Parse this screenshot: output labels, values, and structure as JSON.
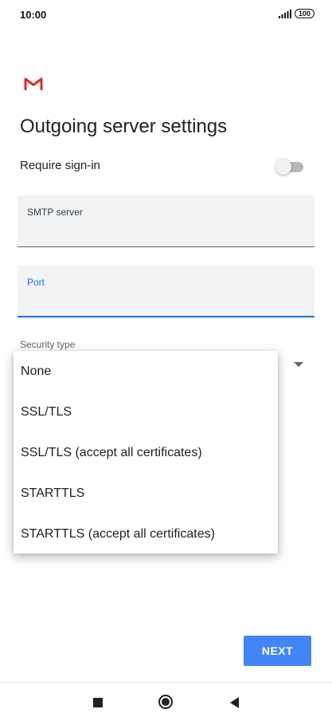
{
  "status_bar": {
    "time": "10:00",
    "battery": "100",
    "icons": [
      "signal-icon",
      "battery-icon"
    ]
  },
  "app": {
    "logo": "gmail-logo",
    "accent_color": "#4285f4",
    "logo_color": "#d93025"
  },
  "page": {
    "title": "Outgoing server settings"
  },
  "require_signin": {
    "label": "Require sign-in",
    "enabled": false
  },
  "fields": {
    "smtp_label": "SMTP server",
    "smtp_value": "",
    "port_label": "Port",
    "port_value": ""
  },
  "security": {
    "label": "Security type",
    "options": [
      "None",
      "SSL/TLS",
      "SSL/TLS (accept all certificates)",
      "STARTTLS",
      "STARTTLS (accept all certificates)"
    ]
  },
  "buttons": {
    "next": "NEXT"
  },
  "nav_bar": {
    "icons": [
      "recents-icon",
      "home-icon",
      "back-icon"
    ]
  }
}
